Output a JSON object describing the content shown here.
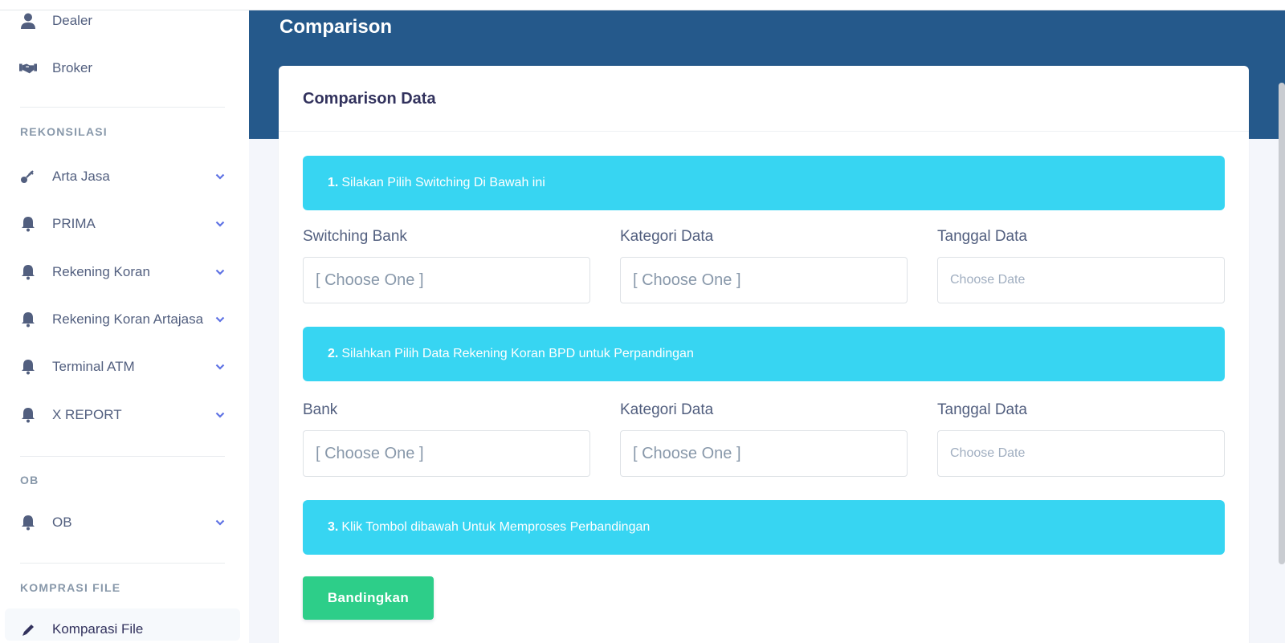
{
  "sidebar": {
    "items_top": [
      {
        "label": "Dealer",
        "icon": "user-icon"
      },
      {
        "label": "Broker",
        "icon": "handshake-icon"
      }
    ],
    "sections": [
      {
        "heading": "REKONSILASI",
        "items": [
          {
            "label": "Arta Jasa",
            "icon": "key-icon"
          },
          {
            "label": "PRIMA",
            "icon": "bell-icon"
          },
          {
            "label": "Rekening Koran",
            "icon": "bell-icon"
          },
          {
            "label": "Rekening Koran Artajasa",
            "icon": "bell-icon"
          },
          {
            "label": "Terminal ATM",
            "icon": "bell-icon"
          },
          {
            "label": "X REPORT",
            "icon": "bell-icon"
          }
        ]
      },
      {
        "heading": "OB",
        "items": [
          {
            "label": "OB",
            "icon": "bell-icon"
          }
        ]
      },
      {
        "heading": "KOMPRASI FILE",
        "items": [
          {
            "label": "Komparasi File",
            "icon": "pen-icon"
          }
        ]
      }
    ]
  },
  "main": {
    "page_title": "Comparison",
    "card_title": "Comparison Data",
    "steps": [
      {
        "number": "1.",
        "text": "Silakan Pilih Switching Di Bawah ini"
      },
      {
        "number": "2.",
        "text": "Silahkan Pilih Data Rekening Koran BPD untuk Perpandingan"
      },
      {
        "number": "3.",
        "text": "Klik Tombol dibawah Untuk Memproses Perbandingan"
      }
    ],
    "row1": [
      {
        "label": "Switching Bank",
        "placeholder": "[ Choose One ]"
      },
      {
        "label": "Kategori Data",
        "placeholder": "[ Choose One ]"
      },
      {
        "label": "Tanggal Data",
        "placeholder": "Choose Date"
      }
    ],
    "row2": [
      {
        "label": "Bank",
        "placeholder": "[ Choose One ]"
      },
      {
        "label": "Kategori Data",
        "placeholder": "[ Choose One ]"
      },
      {
        "label": "Tanggal Data",
        "placeholder": "Choose Date"
      }
    ],
    "button_label": "Bandingkan"
  },
  "colors": {
    "header": "#25598b",
    "step_bg": "#37d5f2",
    "button": "#2dce89",
    "chevron": "#5e72e4"
  }
}
